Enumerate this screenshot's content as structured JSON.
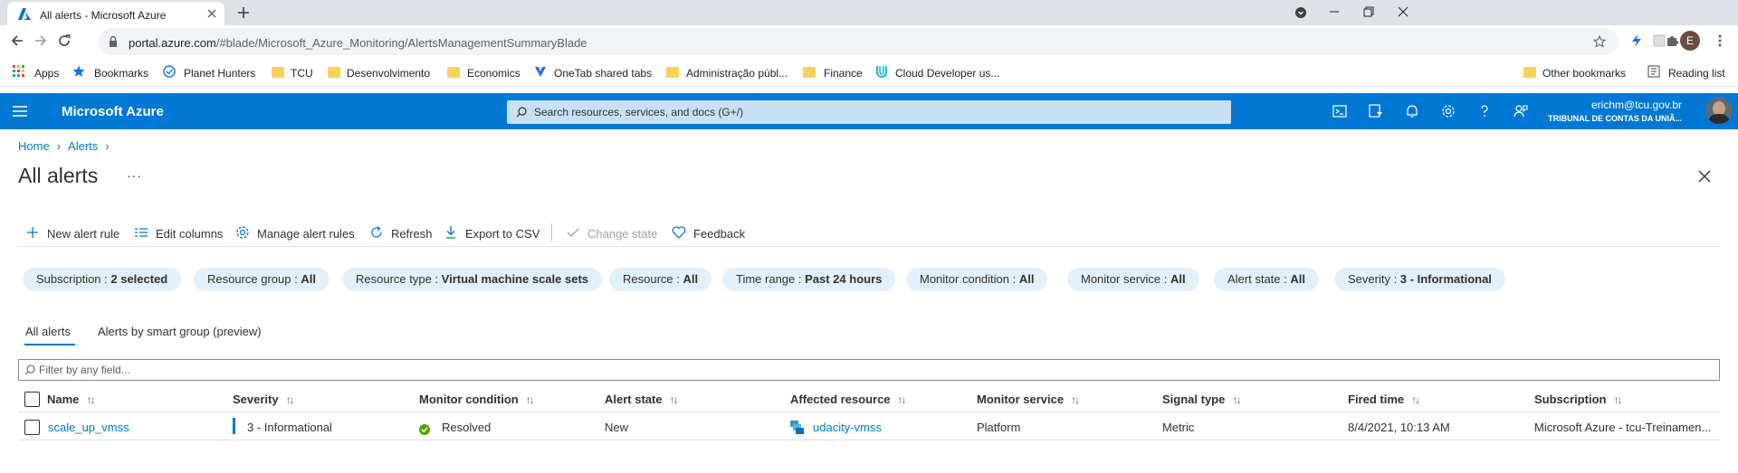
{
  "browser": {
    "tab_title": "All alerts - Microsoft Azure",
    "url_host": "portal.azure.com",
    "url_path": "/#blade/Microsoft_Azure_Monitoring/AlertsManagementSummaryBlade",
    "profile_initial": "E"
  },
  "bookmarks": {
    "items": [
      {
        "label": "Apps",
        "icon": "apps-grid-icon"
      },
      {
        "label": "Bookmarks",
        "icon": "star-icon"
      },
      {
        "label": "Planet Hunters",
        "icon": "globe-icon"
      },
      {
        "label": "TCU",
        "icon": "folder-icon"
      },
      {
        "label": "Desenvolvimento",
        "icon": "folder-icon"
      },
      {
        "label": "Economics",
        "icon": "folder-icon"
      },
      {
        "label": "OneTab shared tabs",
        "icon": "onetab-icon"
      },
      {
        "label": "Administração públ...",
        "icon": "folder-icon"
      },
      {
        "label": "Finance",
        "icon": "folder-icon"
      },
      {
        "label": "Cloud Developer us...",
        "icon": "udacity-icon"
      }
    ],
    "other": "Other bookmarks",
    "reading_list": "Reading list"
  },
  "azure": {
    "brand": "Microsoft Azure",
    "search_placeholder": "Search resources, services, and docs (G+/)",
    "account_email": "erichm@tcu.gov.br",
    "account_org": "TRIBUNAL DE CONTAS DA UNIÃ...",
    "brand_color": "#0078d4"
  },
  "breadcrumb": [
    "Home",
    "Alerts"
  ],
  "page": {
    "title": "All alerts",
    "more": "···"
  },
  "commands": [
    {
      "label": "New alert rule",
      "icon": "plus-icon",
      "disabled": false
    },
    {
      "label": "Edit columns",
      "icon": "columns-icon",
      "disabled": false
    },
    {
      "label": "Manage alert rules",
      "icon": "gear-icon",
      "disabled": false
    },
    {
      "label": "Refresh",
      "icon": "refresh-icon",
      "disabled": false
    },
    {
      "label": "Export to CSV",
      "icon": "download-icon",
      "disabled": false
    },
    {
      "label": "Change state",
      "icon": "checkmark-icon",
      "disabled": true
    },
    {
      "label": "Feedback",
      "icon": "heart-icon",
      "disabled": false
    }
  ],
  "filters": [
    {
      "key": "Subscription : ",
      "value": "2 selected"
    },
    {
      "key": "Resource group : ",
      "value": "All"
    },
    {
      "key": "Resource type : ",
      "value": "Virtual machine scale sets"
    },
    {
      "key": "Resource : ",
      "value": "All"
    },
    {
      "key": "Time range : ",
      "value": "Past 24 hours"
    },
    {
      "key": "Monitor condition : ",
      "value": "All"
    },
    {
      "key": "Monitor service : ",
      "value": "All"
    },
    {
      "key": "Alert state : ",
      "value": "All"
    },
    {
      "key": "Severity : ",
      "value": "3 - Informational"
    }
  ],
  "tabs": [
    {
      "label": "All alerts",
      "active": true
    },
    {
      "label": "Alerts by smart group (preview)",
      "active": false
    }
  ],
  "filter_placeholder": "Filter by any field...",
  "table": {
    "sort_glyph": "↑↓",
    "columns": [
      "Name",
      "Severity",
      "Monitor condition",
      "Alert state",
      "Affected resource",
      "Monitor service",
      "Signal type",
      "Fired time",
      "Subscription"
    ],
    "rows": [
      {
        "name": "scale_up_vmss",
        "severity": "3 - Informational",
        "monitor_condition": "Resolved",
        "alert_state": "New",
        "affected_resource": "udacity-vmss",
        "monitor_service": "Platform",
        "signal_type": "Metric",
        "fired_time": "8/4/2021, 10:13 AM",
        "subscription": "Microsoft Azure - tcu-Treinamen..."
      }
    ]
  }
}
